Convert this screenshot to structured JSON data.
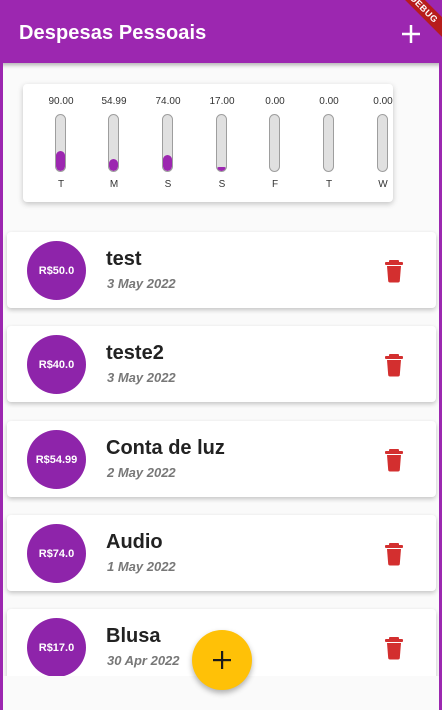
{
  "appbar": {
    "title": "Despesas Pessoais",
    "add_icon": "plus-icon",
    "debug_banner": "DEBUG"
  },
  "colors": {
    "primary": "#9c27b0",
    "avatar": "#8e24aa",
    "accent": "#ffc107",
    "danger": "#d32f2f"
  },
  "chart": {
    "bars": [
      {
        "value": "90.00",
        "day": "T",
        "fill": 0.35
      },
      {
        "value": "54.99",
        "day": "M",
        "fill": 0.21
      },
      {
        "value": "74.00",
        "day": "S",
        "fill": 0.29
      },
      {
        "value": "17.00",
        "day": "S",
        "fill": 0.07
      },
      {
        "value": "0.00",
        "day": "F",
        "fill": 0
      },
      {
        "value": "0.00",
        "day": "T",
        "fill": 0
      },
      {
        "value": "0.00",
        "day": "W",
        "fill": 0
      }
    ]
  },
  "transactions": [
    {
      "amount": "R$50.0",
      "title": "test",
      "date": "3 May 2022"
    },
    {
      "amount": "R$40.0",
      "title": "teste2",
      "date": "3 May 2022"
    },
    {
      "amount": "R$54.99",
      "title": "Conta de luz",
      "date": "2 May 2022"
    },
    {
      "amount": "R$74.0",
      "title": "Audio",
      "date": "1 May 2022"
    },
    {
      "amount": "R$17.0",
      "title": "Blusa",
      "date": "30 Apr 2022"
    }
  ],
  "fab": {
    "icon": "plus-icon"
  }
}
